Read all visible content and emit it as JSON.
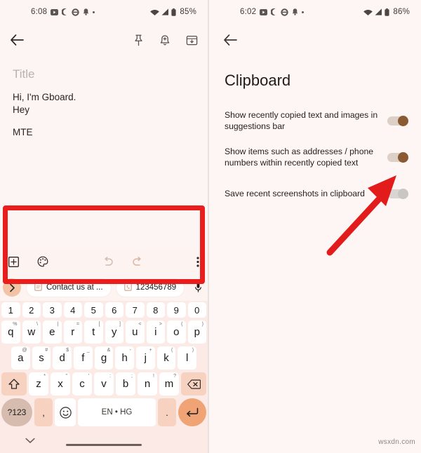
{
  "left_screen": {
    "status_bar": {
      "time": "6:08",
      "battery": "85%",
      "icons": [
        "youtube-icon",
        "crescent-moon-icon",
        "chat-icon",
        "bell-icon",
        "dot-icon",
        "wifi-icon",
        "signal-icon",
        "battery-icon"
      ]
    },
    "app_bar": {
      "back": "back-arrow-icon",
      "actions": [
        "pin-icon",
        "reminder-bell-icon",
        "archive-icon"
      ]
    },
    "note": {
      "title_placeholder": "Title",
      "lines": [
        "Hi, I'm Gboard.",
        "Hey"
      ],
      "extra_line": "MTE"
    },
    "keyboard": {
      "toolbar_icons": [
        "plus-box-icon",
        "palette-icon",
        "undo-icon",
        "redo-icon",
        "overflow-menu-icon"
      ],
      "expand_chevron": "chevron-right-icon",
      "suggestions": [
        {
          "icon": "clipboard-icon",
          "label": "Contact us at ..."
        },
        {
          "icon": "clipboard-phone-icon",
          "label": "123456789"
        }
      ],
      "mic": "microphone-icon",
      "number_row": [
        "1",
        "2",
        "3",
        "4",
        "5",
        "6",
        "7",
        "8",
        "9",
        "0"
      ],
      "row1": [
        {
          "key": "q",
          "sup": "%"
        },
        {
          "key": "w",
          "sup": "\\"
        },
        {
          "key": "e",
          "sup": "|"
        },
        {
          "key": "r",
          "sup": "="
        },
        {
          "key": "t",
          "sup": "["
        },
        {
          "key": "y",
          "sup": "]"
        },
        {
          "key": "u",
          "sup": "<"
        },
        {
          "key": "i",
          "sup": ">"
        },
        {
          "key": "o",
          "sup": "("
        },
        {
          "key": "p",
          "sup": ")"
        }
      ],
      "row2": [
        {
          "key": "a",
          "sup": "@"
        },
        {
          "key": "s",
          "sup": "#"
        },
        {
          "key": "d",
          "sup": "$"
        },
        {
          "key": "f",
          "sup": "_"
        },
        {
          "key": "g",
          "sup": "&"
        },
        {
          "key": "h",
          "sup": "-"
        },
        {
          "key": "j",
          "sup": "+"
        },
        {
          "key": "k",
          "sup": "("
        },
        {
          "key": "l",
          "sup": ")"
        }
      ],
      "row3": [
        {
          "key": "z",
          "sup": "*"
        },
        {
          "key": "x",
          "sup": "\""
        },
        {
          "key": "c",
          "sup": "'"
        },
        {
          "key": "v",
          "sup": ":"
        },
        {
          "key": "b",
          "sup": ";"
        },
        {
          "key": "n",
          "sup": "!"
        },
        {
          "key": "m",
          "sup": "?"
        }
      ],
      "shift": "shift-icon",
      "backspace": "backspace-icon",
      "symbols_key": "?123",
      "comma_key": ",",
      "emoji_key": "emoji-icon",
      "space_key": "EN • HG",
      "period_key": ".",
      "enter_key": "enter-icon",
      "collapse_chevron": "chevron-down-icon"
    },
    "highlight_box": {
      "color": "#ea1c1c"
    }
  },
  "right_screen": {
    "status_bar": {
      "time": "6:02",
      "battery": "86%"
    },
    "app_bar": {
      "back": "back-arrow-icon"
    },
    "title": "Clipboard",
    "settings": [
      {
        "label": "Show recently copied text and images in suggestions bar",
        "state": "on"
      },
      {
        "label": "Show items such as addresses / phone numbers within recently copied text",
        "state": "on"
      },
      {
        "label": "Save recent screenshots in clipboard",
        "state": "off"
      }
    ],
    "annotation_arrow": {
      "color": "#e21b1b",
      "points_to": "second-toggle"
    }
  },
  "watermark": "wsxdn.com",
  "colors": {
    "accent_brown": "#8a5a32",
    "keyboard_bg": "#fbeae5",
    "annotation_red": "#ea1c1c"
  }
}
